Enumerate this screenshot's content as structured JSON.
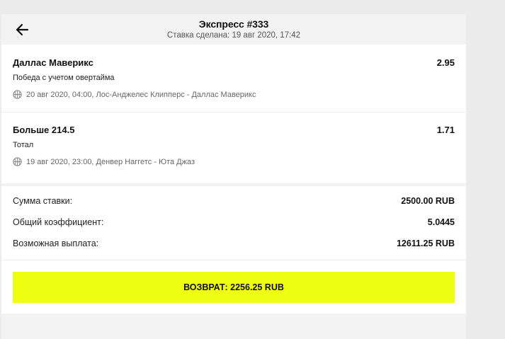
{
  "header": {
    "title": "Экспресс #333",
    "subtitle": "Ставка сделана: 19 авг 2020, 17:42",
    "back_icon": "arrow-left-icon"
  },
  "events": [
    {
      "name": "Даллас Маверикс",
      "odds": "2.95",
      "market": "Победа с учетом овертайма",
      "sport_icon": "basketball-icon",
      "meta": "20 авг 2020, 04:00, Лос-Анджелес Клипперс - Даллас Маверикс"
    },
    {
      "name": "Больше 214.5",
      "odds": "1.71",
      "market": "Тотал",
      "sport_icon": "basketball-icon",
      "meta": "19 авг 2020, 23:00, Денвер Наггетс - Юта Джаз"
    }
  ],
  "summary": {
    "stake_label": "Сумма ставки:",
    "stake_value": "2500.00 RUB",
    "coef_label": "Общий коэффициент:",
    "coef_value": "5.0445",
    "payout_label": "Возможная выплата:",
    "payout_value": "12611.25 RUB"
  },
  "refund_button": {
    "label": "ВОЗВРАТ: 2256.25 RUB",
    "color": "#efff12"
  }
}
